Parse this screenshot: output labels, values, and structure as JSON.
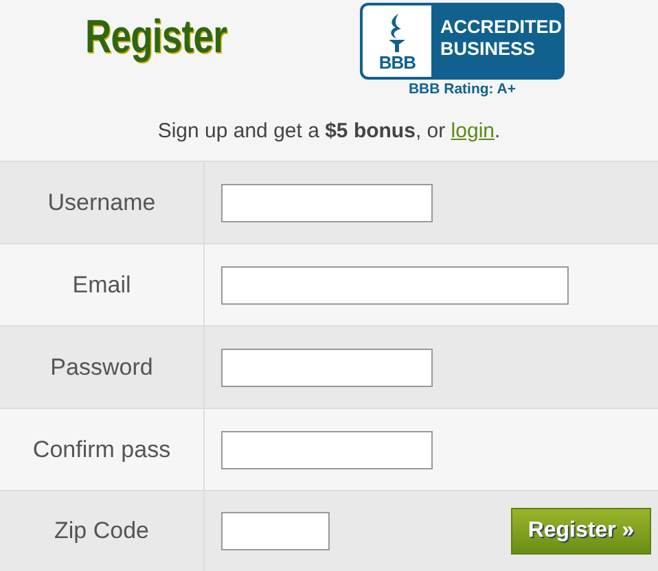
{
  "title": "Register",
  "badge": {
    "line_1": "ACCREDITED",
    "line_2": "BUSINESS",
    "mark": "BBB",
    "rating": "BBB Rating: A+"
  },
  "intro": {
    "text": "Sign up and get a **$5 bonus**, or ",
    "link": "login",
    "end": "."
  },
  "fields": [
    {
      "label": "Username",
      "kind": "text"
    },
    {
      "label": "Email",
      "kind": "email"
    },
    {
      "label": "Password",
      "kind": "password"
    },
    {
      "label": "Confirm pass",
      "kind": "password"
    },
    {
      "label": "Zip Code",
      "kind": "zip"
    }
  ],
  "submit": "Register »"
}
